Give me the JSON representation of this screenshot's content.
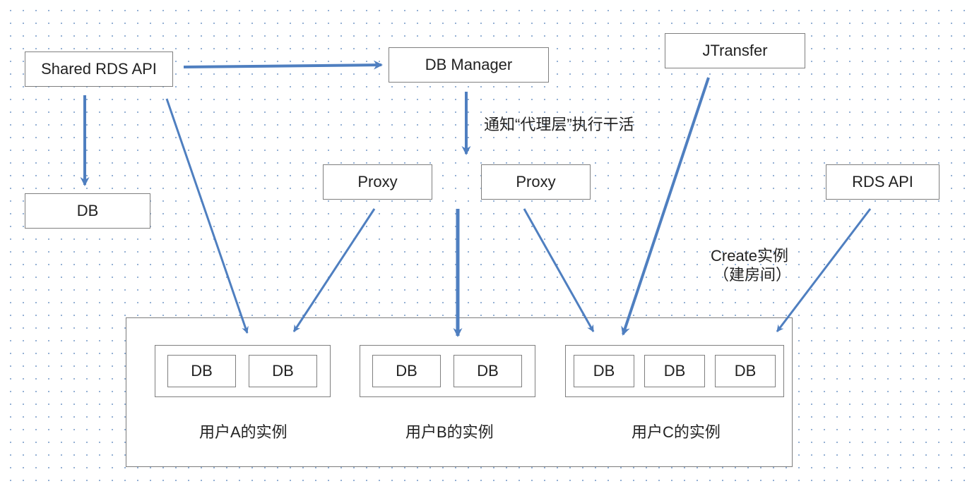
{
  "nodes": {
    "shared_rds_api": "Shared RDS API",
    "db_manager": "DB Manager",
    "jtransfer": "JTransfer",
    "db_left": "DB",
    "proxy1": "Proxy",
    "proxy2": "Proxy",
    "rds_api": "RDS API",
    "db_a1": "DB",
    "db_a2": "DB",
    "db_b1": "DB",
    "db_b2": "DB",
    "db_c1": "DB",
    "db_c2": "DB",
    "db_c3": "DB"
  },
  "labels": {
    "notify_proxy": "通知“代理层”执行干活",
    "create_instance_line1": "Create实例",
    "create_instance_line2": "（建房间）",
    "user_a_instance": "用户A的实例",
    "user_b_instance": "用户B的实例",
    "user_c_instance": "用户C的实例"
  },
  "colors": {
    "arrow": "#4f7fc0",
    "border": "#7f7f7f"
  }
}
